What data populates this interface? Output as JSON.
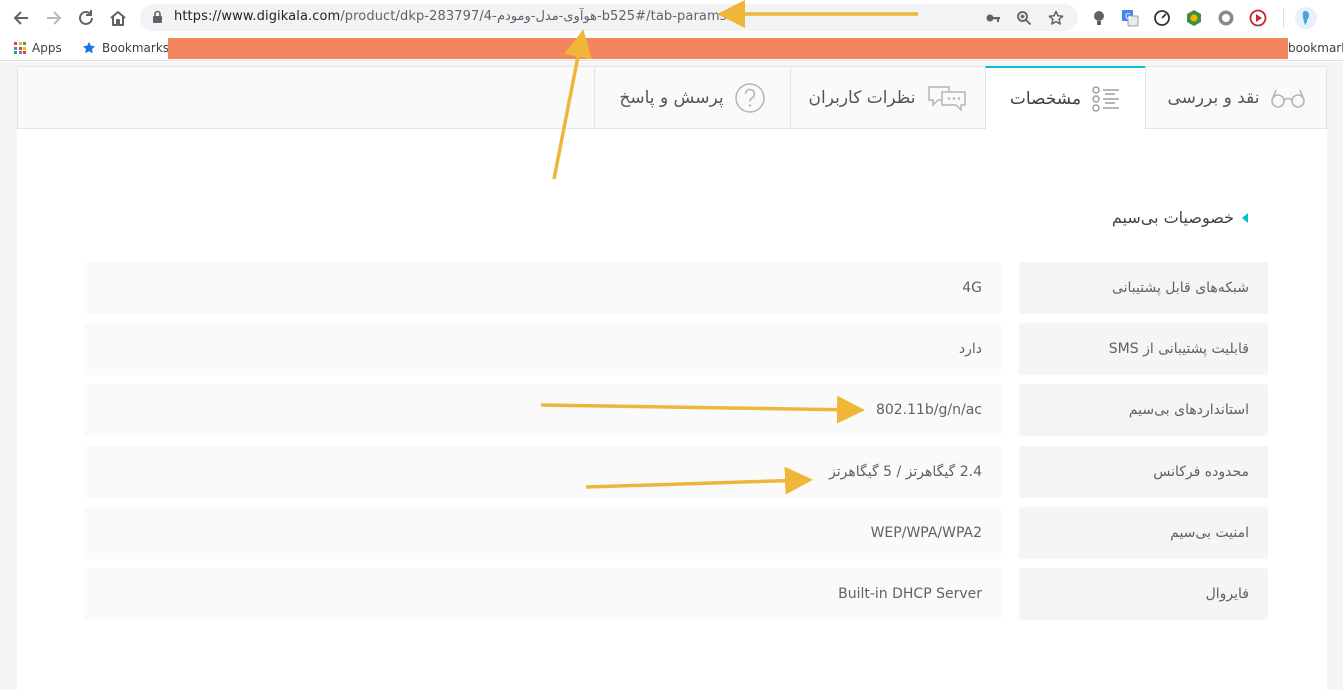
{
  "browser": {
    "url_prefix": "https://www.digikala.com",
    "url_path": "/product/dkp-283797/4-هوآوی-مدل-ومودم-b525#/tab-params",
    "nav_icons": [
      "back-icon",
      "forward-icon",
      "reload-icon",
      "home-icon"
    ],
    "omnibox_icons": [
      "key-icon",
      "zoom-icon",
      "star-icon"
    ]
  },
  "bookmarks": {
    "apps_label": "Apps",
    "bookmarks_label": "Bookmarks",
    "other_label": "bookmarks"
  },
  "tabs": [
    {
      "label": "نقد و بررسی",
      "icon": "glasses-icon",
      "active": false
    },
    {
      "label": "مشخصات",
      "icon": "checklist-icon",
      "active": true
    },
    {
      "label": "نظرات کاربران",
      "icon": "comments-icon",
      "active": false
    },
    {
      "label": "پرسش و پاسخ",
      "icon": "question-icon",
      "active": false
    }
  ],
  "section": {
    "title": "خصوصیات بی‌سیم"
  },
  "specs": [
    {
      "label": "شبکه‌های قابل پشتیبانی",
      "value": "4G"
    },
    {
      "label": "قابلیت پشتیبانی از SMS",
      "value": "دارد"
    },
    {
      "label": "استانداردهای بی‌سیم",
      "value": "802.11b/g/n/ac"
    },
    {
      "label": "محدوده فرکانس",
      "value": "2.4 گیگاهرتز / 5 گیگاهرتز"
    },
    {
      "label": "امنیت بی‌سیم",
      "value": "WEP/WPA/WPA2"
    },
    {
      "label": "فایروال",
      "value": "Built-in DHCP Server"
    }
  ],
  "colors": {
    "accent": "#00bfd6",
    "annotation_arrow": "#f0b63a",
    "redaction": "#f4865f"
  }
}
